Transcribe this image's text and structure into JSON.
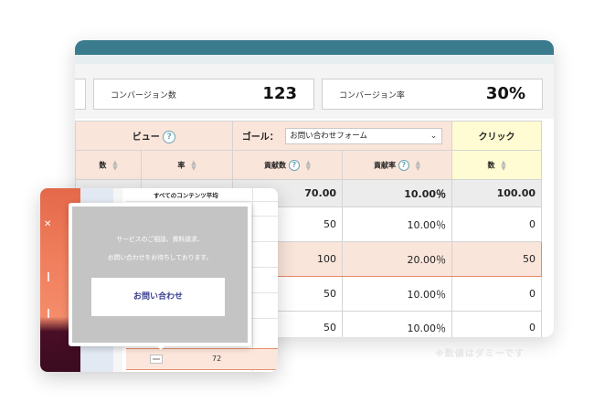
{
  "stats": {
    "conversions": {
      "label": "コンバージョン数",
      "value": "123"
    },
    "conversion_rate": {
      "label": "コンバージョン率",
      "value": "30%"
    }
  },
  "table": {
    "group_view": "ビュー",
    "goal_label": "ゴール：",
    "goal_select_value": "お問い合わせフォーム",
    "group_click": "クリック",
    "help_glyph": "?",
    "columns": [
      "数",
      "率",
      "貢献数",
      "貢献率",
      "数"
    ],
    "average_row": [
      "",
      "",
      "70.00",
      "10.00％",
      "100.00"
    ],
    "rows": [
      [
        "",
        "",
        "50",
        "10.00％",
        "0"
      ],
      [
        "",
        "",
        "100",
        "20.00％",
        "50"
      ],
      [
        "",
        "",
        "50",
        "10.00％",
        "0"
      ],
      [
        "",
        "",
        "50",
        "10.00％",
        "0"
      ]
    ]
  },
  "popup": {
    "inner_table_header": "すべてのコンテンツ平均",
    "overlay_line1": "サービスのご相談、資料請求、",
    "overlay_line2": "お問い合わせをお待ちしております。",
    "overlay_button": "お問い合わせ",
    "row_number": "72"
  },
  "watermark": "※数値はダミーです"
}
